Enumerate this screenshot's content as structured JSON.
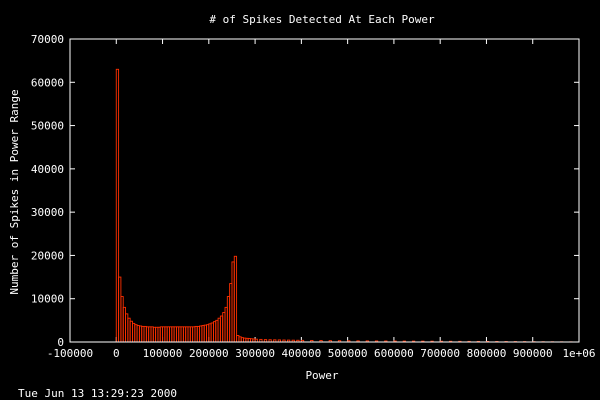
{
  "chart_data": {
    "type": "bar",
    "title": "# of Spikes Detected At Each Power",
    "xlabel": "Power",
    "ylabel": "Number of Spikes in Power Range",
    "xlim": [
      -100000,
      1000000
    ],
    "ylim": [
      0,
      70000
    ],
    "x_ticks": [
      -100000,
      0,
      100000,
      200000,
      300000,
      400000,
      500000,
      600000,
      700000,
      800000,
      900000,
      1000000
    ],
    "x_tick_labels": [
      "-100000",
      "0",
      "100000",
      "200000",
      "300000",
      "400000",
      "500000",
      "600000",
      "700000",
      "800000",
      "900000",
      "1e+06"
    ],
    "y_ticks": [
      0,
      10000,
      20000,
      30000,
      40000,
      50000,
      60000,
      70000
    ],
    "y_tick_labels": [
      "0",
      "10000",
      "20000",
      "30000",
      "40000",
      "50000",
      "60000",
      "70000"
    ],
    "bar_color": "#ff3000",
    "bin_width": 5000,
    "series": [
      {
        "x": [
          0,
          5000,
          10000,
          15000,
          20000,
          25000,
          30000,
          35000,
          40000,
          45000,
          50000,
          55000,
          60000,
          65000,
          70000,
          75000,
          80000,
          85000,
          90000,
          95000,
          100000,
          105000,
          110000,
          115000,
          120000,
          125000,
          130000,
          135000,
          140000,
          145000,
          150000,
          155000,
          160000,
          165000,
          170000,
          175000,
          180000,
          185000,
          190000,
          195000,
          200000,
          205000,
          210000,
          215000,
          220000,
          225000,
          230000,
          235000,
          240000,
          245000,
          250000,
          255000,
          260000,
          265000,
          270000,
          275000,
          280000,
          285000,
          290000,
          295000,
          300000,
          310000,
          320000,
          330000,
          340000,
          350000,
          360000,
          370000,
          380000,
          390000,
          400000,
          420000,
          440000,
          460000,
          480000,
          500000,
          520000,
          540000,
          560000,
          580000,
          600000,
          620000,
          640000,
          660000,
          680000,
          700000,
          720000,
          740000,
          760000,
          780000,
          800000,
          820000,
          840000,
          860000,
          880000,
          900000,
          920000,
          940000,
          960000,
          980000
        ],
        "values": [
          63000,
          15000,
          10500,
          8000,
          6500,
          5500,
          4800,
          4300,
          4000,
          3800,
          3700,
          3600,
          3600,
          3500,
          3500,
          3500,
          3400,
          3400,
          3400,
          3500,
          3500,
          3500,
          3500,
          3500,
          3500,
          3500,
          3500,
          3500,
          3500,
          3500,
          3500,
          3500,
          3500,
          3500,
          3600,
          3600,
          3700,
          3800,
          3900,
          4000,
          4200,
          4400,
          4700,
          5000,
          5500,
          6000,
          6800,
          8000,
          10500,
          13500,
          18500,
          19800,
          1500,
          1200,
          1000,
          900,
          850,
          800,
          750,
          700,
          650,
          600,
          550,
          520,
          500,
          480,
          460,
          440,
          420,
          400,
          380,
          360,
          340,
          320,
          300,
          280,
          270,
          260,
          250,
          240,
          230,
          220,
          210,
          200,
          190,
          180,
          170,
          160,
          150,
          140,
          130,
          120,
          110,
          100,
          90,
          80,
          70,
          60,
          50,
          40
        ]
      }
    ]
  },
  "timestamp": "Tue Jun 13 13:29:23 2000"
}
